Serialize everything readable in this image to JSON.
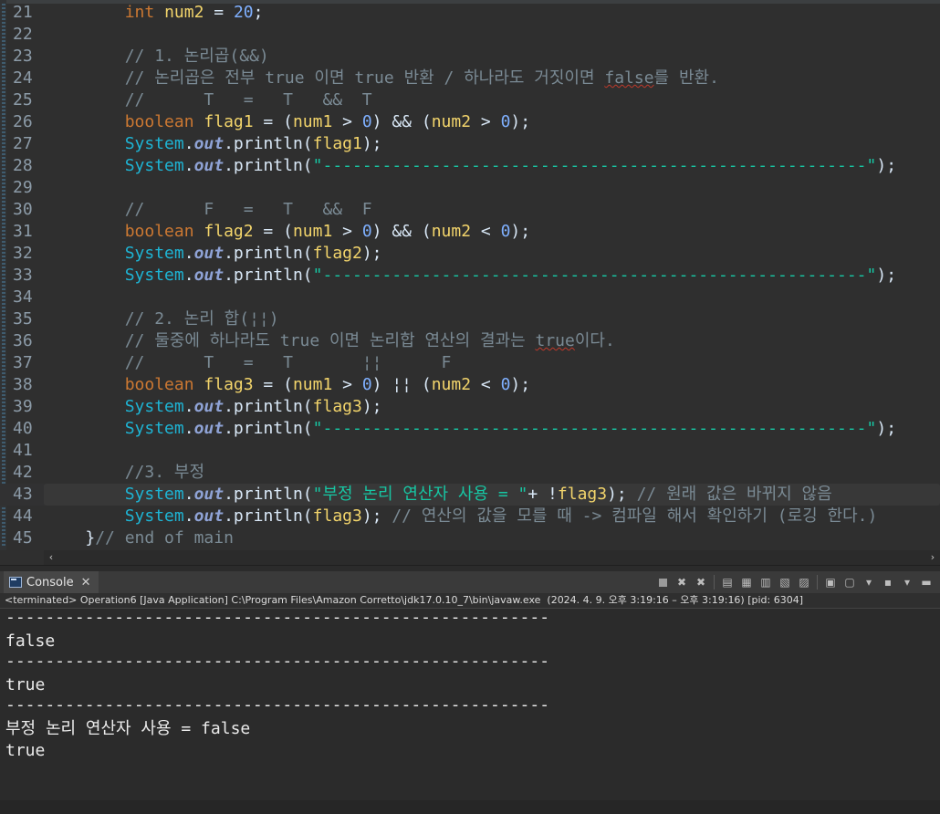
{
  "editor": {
    "lines": [
      {
        "n": "21",
        "tokens": [
          {
            "t": "        "
          },
          {
            "t": "int",
            "c": "kw"
          },
          {
            "t": " "
          },
          {
            "t": "num2",
            "c": "var"
          },
          {
            "t": " = "
          },
          {
            "t": "20",
            "c": "num"
          },
          {
            "t": ";"
          }
        ]
      },
      {
        "n": "22",
        "tokens": []
      },
      {
        "n": "23",
        "tokens": [
          {
            "t": "        "
          },
          {
            "t": "// 1. 논리곱(&&)",
            "c": "cmt"
          }
        ]
      },
      {
        "n": "24",
        "tokens": [
          {
            "t": "        "
          },
          {
            "t": "// 논리곱은 전부 true 이면 true 반환 / 하나라도 거짓이면 ",
            "c": "cmt"
          },
          {
            "t": "false",
            "c": "cmt",
            "sq": true
          },
          {
            "t": "를 반환.",
            "c": "cmt"
          }
        ]
      },
      {
        "n": "25",
        "tokens": [
          {
            "t": "        "
          },
          {
            "t": "//      T   =   T   &&  T",
            "c": "cmt"
          }
        ]
      },
      {
        "n": "26",
        "tokens": [
          {
            "t": "        "
          },
          {
            "t": "boolean",
            "c": "kw"
          },
          {
            "t": " "
          },
          {
            "t": "flag1",
            "c": "var"
          },
          {
            "t": " = ("
          },
          {
            "t": "num1",
            "c": "var"
          },
          {
            "t": " > "
          },
          {
            "t": "0",
            "c": "num"
          },
          {
            "t": ") && ("
          },
          {
            "t": "num2",
            "c": "var"
          },
          {
            "t": " > "
          },
          {
            "t": "0",
            "c": "num"
          },
          {
            "t": ");"
          }
        ]
      },
      {
        "n": "27",
        "tokens": [
          {
            "t": "        "
          },
          {
            "t": "System",
            "c": "cls"
          },
          {
            "t": "."
          },
          {
            "t": "out",
            "c": "fld"
          },
          {
            "t": ".println("
          },
          {
            "t": "flag1",
            "c": "var"
          },
          {
            "t": ");"
          }
        ]
      },
      {
        "n": "28",
        "tokens": [
          {
            "t": "        "
          },
          {
            "t": "System",
            "c": "cls"
          },
          {
            "t": "."
          },
          {
            "t": "out",
            "c": "fld"
          },
          {
            "t": ".println("
          },
          {
            "t": "\"-------------------------------------------------------\"",
            "c": "str"
          },
          {
            "t": ");"
          }
        ]
      },
      {
        "n": "29",
        "tokens": []
      },
      {
        "n": "30",
        "tokens": [
          {
            "t": "        "
          },
          {
            "t": "//      F   =   T   &&  F",
            "c": "cmt"
          }
        ]
      },
      {
        "n": "31",
        "tokens": [
          {
            "t": "        "
          },
          {
            "t": "boolean",
            "c": "kw"
          },
          {
            "t": " "
          },
          {
            "t": "flag2",
            "c": "var"
          },
          {
            "t": " = ("
          },
          {
            "t": "num1",
            "c": "var"
          },
          {
            "t": " > "
          },
          {
            "t": "0",
            "c": "num"
          },
          {
            "t": ") && ("
          },
          {
            "t": "num2",
            "c": "var"
          },
          {
            "t": " < "
          },
          {
            "t": "0",
            "c": "num"
          },
          {
            "t": ");"
          }
        ]
      },
      {
        "n": "32",
        "tokens": [
          {
            "t": "        "
          },
          {
            "t": "System",
            "c": "cls"
          },
          {
            "t": "."
          },
          {
            "t": "out",
            "c": "fld"
          },
          {
            "t": ".println("
          },
          {
            "t": "flag2",
            "c": "var"
          },
          {
            "t": ");"
          }
        ]
      },
      {
        "n": "33",
        "tokens": [
          {
            "t": "        "
          },
          {
            "t": "System",
            "c": "cls"
          },
          {
            "t": "."
          },
          {
            "t": "out",
            "c": "fld"
          },
          {
            "t": ".println("
          },
          {
            "t": "\"-------------------------------------------------------\"",
            "c": "str"
          },
          {
            "t": ");"
          }
        ]
      },
      {
        "n": "34",
        "tokens": []
      },
      {
        "n": "35",
        "tokens": [
          {
            "t": "        "
          },
          {
            "t": "// 2. 논리 합(¦¦)",
            "c": "cmt"
          }
        ]
      },
      {
        "n": "36",
        "tokens": [
          {
            "t": "        "
          },
          {
            "t": "// 둘중에 하나라도 true 이면 논리합 연산의 결과는 ",
            "c": "cmt"
          },
          {
            "t": "true",
            "c": "cmt",
            "sq": true
          },
          {
            "t": "이다.",
            "c": "cmt"
          }
        ]
      },
      {
        "n": "37",
        "tokens": [
          {
            "t": "        "
          },
          {
            "t": "//      T   =   T       ¦¦      F",
            "c": "cmt"
          }
        ]
      },
      {
        "n": "38",
        "tokens": [
          {
            "t": "        "
          },
          {
            "t": "boolean",
            "c": "kw"
          },
          {
            "t": " "
          },
          {
            "t": "flag3",
            "c": "var"
          },
          {
            "t": " = ("
          },
          {
            "t": "num1",
            "c": "var"
          },
          {
            "t": " > "
          },
          {
            "t": "0",
            "c": "num"
          },
          {
            "t": ") ¦¦ ("
          },
          {
            "t": "num2",
            "c": "var"
          },
          {
            "t": " < "
          },
          {
            "t": "0",
            "c": "num"
          },
          {
            "t": ");"
          }
        ]
      },
      {
        "n": "39",
        "tokens": [
          {
            "t": "        "
          },
          {
            "t": "System",
            "c": "cls"
          },
          {
            "t": "."
          },
          {
            "t": "out",
            "c": "fld"
          },
          {
            "t": ".println("
          },
          {
            "t": "flag3",
            "c": "var"
          },
          {
            "t": ");"
          }
        ]
      },
      {
        "n": "40",
        "tokens": [
          {
            "t": "        "
          },
          {
            "t": "System",
            "c": "cls"
          },
          {
            "t": "."
          },
          {
            "t": "out",
            "c": "fld"
          },
          {
            "t": ".println("
          },
          {
            "t": "\"-------------------------------------------------------\"",
            "c": "str"
          },
          {
            "t": ");"
          }
        ]
      },
      {
        "n": "41",
        "tokens": []
      },
      {
        "n": "42",
        "tokens": [
          {
            "t": "        "
          },
          {
            "t": "//3. 부정",
            "c": "cmt"
          }
        ]
      },
      {
        "n": "43",
        "current": true,
        "tokens": [
          {
            "t": "        "
          },
          {
            "t": "System",
            "c": "cls"
          },
          {
            "t": "."
          },
          {
            "t": "out",
            "c": "fld"
          },
          {
            "t": ".println("
          },
          {
            "t": "\"부정 논리 연산자 사용 = \"",
            "c": "str"
          },
          {
            "t": "+ !"
          },
          {
            "t": "flag3",
            "c": "var"
          },
          {
            "t": "); "
          },
          {
            "t": "// 원래 값은 바뀌지 않음",
            "c": "cmt"
          }
        ]
      },
      {
        "n": "44",
        "tokens": [
          {
            "t": "        "
          },
          {
            "t": "System",
            "c": "cls"
          },
          {
            "t": "."
          },
          {
            "t": "out",
            "c": "fld"
          },
          {
            "t": ".println("
          },
          {
            "t": "flag3",
            "c": "var"
          },
          {
            "t": "); "
          },
          {
            "t": "// 연산의 값을 모를 때 -> 컴파일 해서 확인하기 (로깅 한다.)",
            "c": "cmt"
          }
        ]
      },
      {
        "n": "45",
        "tokens": [
          {
            "t": "    "
          },
          {
            "t": "}"
          },
          {
            "t": "// end of main",
            "c": "cmt"
          }
        ]
      }
    ]
  },
  "scrollbar": {
    "left_arrow": "‹",
    "right_arrow": "›"
  },
  "console": {
    "tab_label": "Console",
    "tab_close": "✕",
    "status": "<terminated> Operation6 [Java Application] C:\\Program Files\\Amazon Corretto\\jdk17.0.10_7\\bin\\javaw.exe  (2024. 4. 9. 오후 3:19:16 – 오후 3:19:16) [pid: 6304]",
    "output": [
      "-------------------------------------------------------",
      "false",
      "-------------------------------------------------------",
      "true",
      "-------------------------------------------------------",
      "부정 논리 연산자 사용 = false",
      "true"
    ],
    "toolbar_icons": [
      "terminate-icon",
      "remove-launch-icon",
      "remove-all-icon",
      "scroll-lock-icon",
      "word-wrap-icon",
      "show-stdout-icon",
      "show-stderr-icon",
      "pin-console-icon",
      "display-console-icon",
      "open-console-icon",
      "minimize-icon"
    ]
  },
  "colors": {
    "keyword": "#cc7832",
    "variable": "#f2d46b",
    "class": "#1eb4d4",
    "static_field": "#8fa3d6",
    "number": "#7fb0ff",
    "string": "#17c6a3",
    "comment": "#7a8a94",
    "background": "#2f2f2f"
  }
}
